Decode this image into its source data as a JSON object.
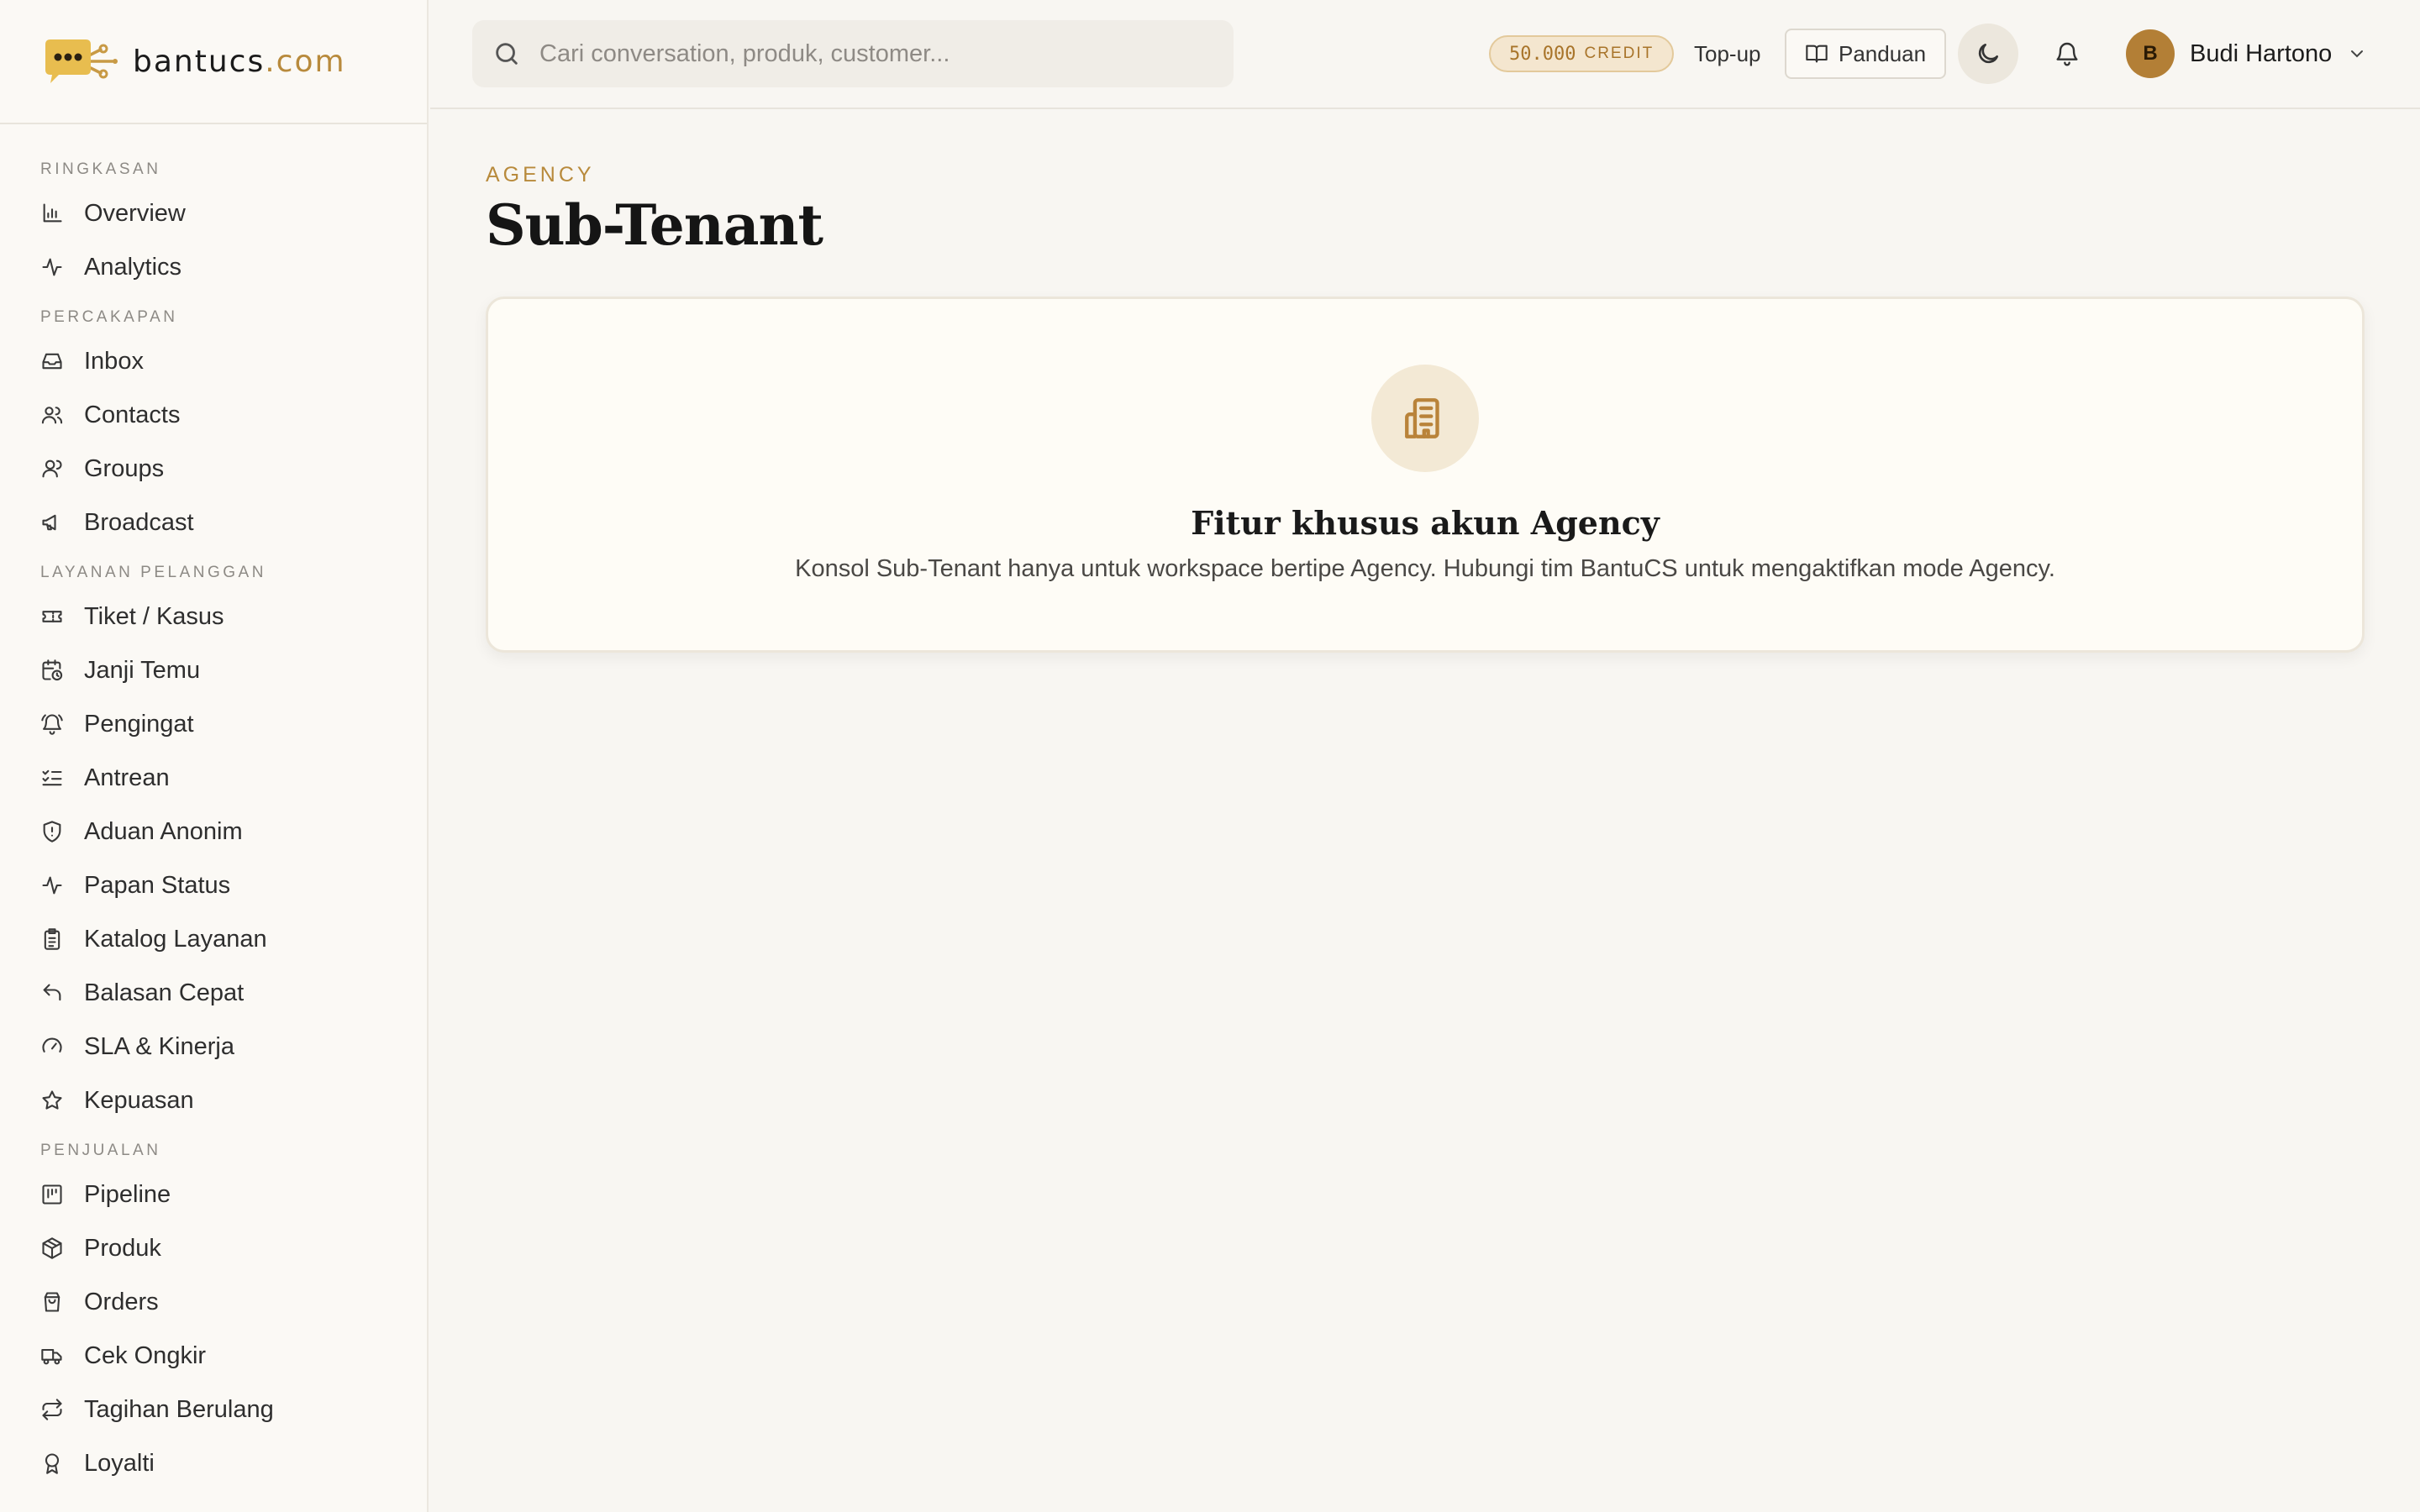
{
  "brand": {
    "name": "bantucs",
    "tld": ".com"
  },
  "sidebar": {
    "sections": [
      {
        "title": "RINGKASAN",
        "items": [
          {
            "label": "Overview",
            "icon": "bar-chart-icon"
          },
          {
            "label": "Analytics",
            "icon": "activity-icon"
          }
        ]
      },
      {
        "title": "PERCAKAPAN",
        "items": [
          {
            "label": "Inbox",
            "icon": "inbox-icon"
          },
          {
            "label": "Contacts",
            "icon": "users-icon"
          },
          {
            "label": "Groups",
            "icon": "user-group-icon"
          },
          {
            "label": "Broadcast",
            "icon": "megaphone-icon"
          }
        ]
      },
      {
        "title": "LAYANAN PELANGGAN",
        "items": [
          {
            "label": "Tiket / Kasus",
            "icon": "ticket-icon"
          },
          {
            "label": "Janji Temu",
            "icon": "calendar-clock-icon"
          },
          {
            "label": "Pengingat",
            "icon": "bell-ring-icon"
          },
          {
            "label": "Antrean",
            "icon": "list-checks-icon"
          },
          {
            "label": "Aduan Anonim",
            "icon": "shield-alert-icon"
          },
          {
            "label": "Papan Status",
            "icon": "activity-icon"
          },
          {
            "label": "Katalog Layanan",
            "icon": "clipboard-list-icon"
          },
          {
            "label": "Balasan Cepat",
            "icon": "reply-icon"
          },
          {
            "label": "SLA & Kinerja",
            "icon": "gauge-icon"
          },
          {
            "label": "Kepuasan",
            "icon": "star-icon"
          }
        ]
      },
      {
        "title": "PENJUALAN",
        "items": [
          {
            "label": "Pipeline",
            "icon": "kanban-icon"
          },
          {
            "label": "Produk",
            "icon": "package-icon"
          },
          {
            "label": "Orders",
            "icon": "shopping-bag-icon"
          },
          {
            "label": "Cek Ongkir",
            "icon": "truck-icon"
          },
          {
            "label": "Tagihan Berulang",
            "icon": "repeat-icon"
          },
          {
            "label": "Loyalti",
            "icon": "award-icon"
          }
        ]
      }
    ]
  },
  "topbar": {
    "search_placeholder": "Cari conversation, produk, customer...",
    "credit_amount": "50.000",
    "credit_unit": "CREDIT",
    "topup_label": "Top-up",
    "guide_label": "Panduan",
    "user_initial": "B",
    "user_name": "Budi Hartono"
  },
  "main": {
    "eyebrow": "AGENCY",
    "title": "Sub-Tenant",
    "card": {
      "icon": "building-icon",
      "title": "Fitur khusus akun Agency",
      "description": "Konsol Sub-Tenant hanya untuk workspace bertipe Agency. Hubungi tim BantuCS untuk mengaktifkan mode Agency."
    }
  },
  "colors": {
    "accent": "#b88a3c",
    "background": "#f8f6f2",
    "sidebar": "#fbf9f5",
    "card": "#fefcf6"
  }
}
